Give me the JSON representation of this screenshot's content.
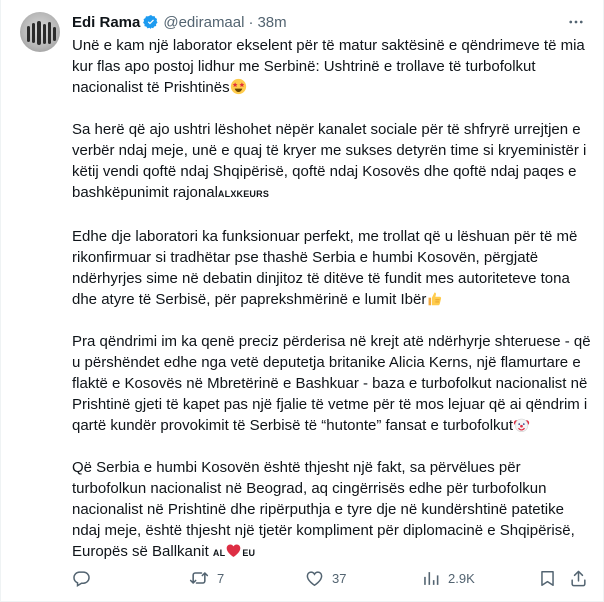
{
  "tweet": {
    "author_name": "Edi Rama",
    "handle": "@ediramaal",
    "separator": "·",
    "time": "38m",
    "paragraphs": [
      {
        "text": "Unë e kam një laborator ekselent për të matur saktësinë e qëndrimeve të mia kur flas apo postoj lidhur me Serbinë: Ushtrinë e trollave të turbofolkut nacionalist të Prishtinës",
        "suffix_emoji": "star-struck-emoji"
      },
      {
        "text": "Sa herë që ajo ushtri lëshohet nëpër kanalet sociale për të shfryrë urrejtjen e verbër ndaj meje, unë e quaj të kryer me sukses detyrën time si kryeministër i këtij vendi qoftë ndaj Shqipërisë, qoftë ndaj Kosovës dhe qoftë ndaj paqes e bashkëpunimit rajonal",
        "suffix_tag": "ALXKEURS"
      },
      {
        "text": "Edhe dje laboratori ka funksionuar perfekt, me trollat që u lëshuan për të më rikonfirmuar si tradhëtar pse thashë Serbia e humbi Kosovën, përgjatë ndërhyrjes sime në debatin dinjitoz të ditëve të fundit mes autoriteteve tona dhe atyre të Serbisë, për paprekshmërinë e lumit Ibër",
        "suffix_emoji": "thumbs-up-emoji"
      },
      {
        "text": "Pra qëndrimi im ka qenë preciz përderisa në krejt atë ndërhyrje shteruese - që u përshëndet edhe nga vetë deputetja britanike Alicia Kerns, një flamurtare e flaktë e Kosovës në Mbretërinë e Bashkuar - baza e turbofolkut nacionalist në Prishtinë gjeti të kapet pas një fjalie të vetme për të mos lejuar që ai qëndrim i qartë kundër provokimit të Serbisë të “hutonte” fansat e turbofolkut",
        "suffix_emoji": "clown-emoji"
      },
      {
        "text": "Që  Serbia e humbi Kosovën është thjesht një fakt, sa përvëlues për turbofolkun nacionalist në Beograd, aq cingërrisës edhe për turbofolkun nacionalist në Prishtinë dhe ripërputhja e tyre dje në kundërshtinë patetike ndaj meje, është thjesht një tjetër kompliment për diplomacinë e Shqipërisë, Europës së Ballkanit",
        "suffix_tag": "AL",
        "suffix_emoji": "red-heart-emoji",
        "suffix_tag2": "EU"
      }
    ],
    "actions": {
      "replies": "",
      "reposts": "7",
      "likes": "37",
      "views": "2.9K"
    }
  },
  "colors": {
    "text": "#0f1419",
    "muted": "#536471",
    "verified_badge": "#1d9bf0",
    "border": "#eff3f4"
  },
  "icons": [
    "verified-badge-icon",
    "more-options-icon",
    "reply-icon",
    "repost-icon",
    "like-icon",
    "views-icon",
    "bookmark-icon",
    "share-icon"
  ]
}
